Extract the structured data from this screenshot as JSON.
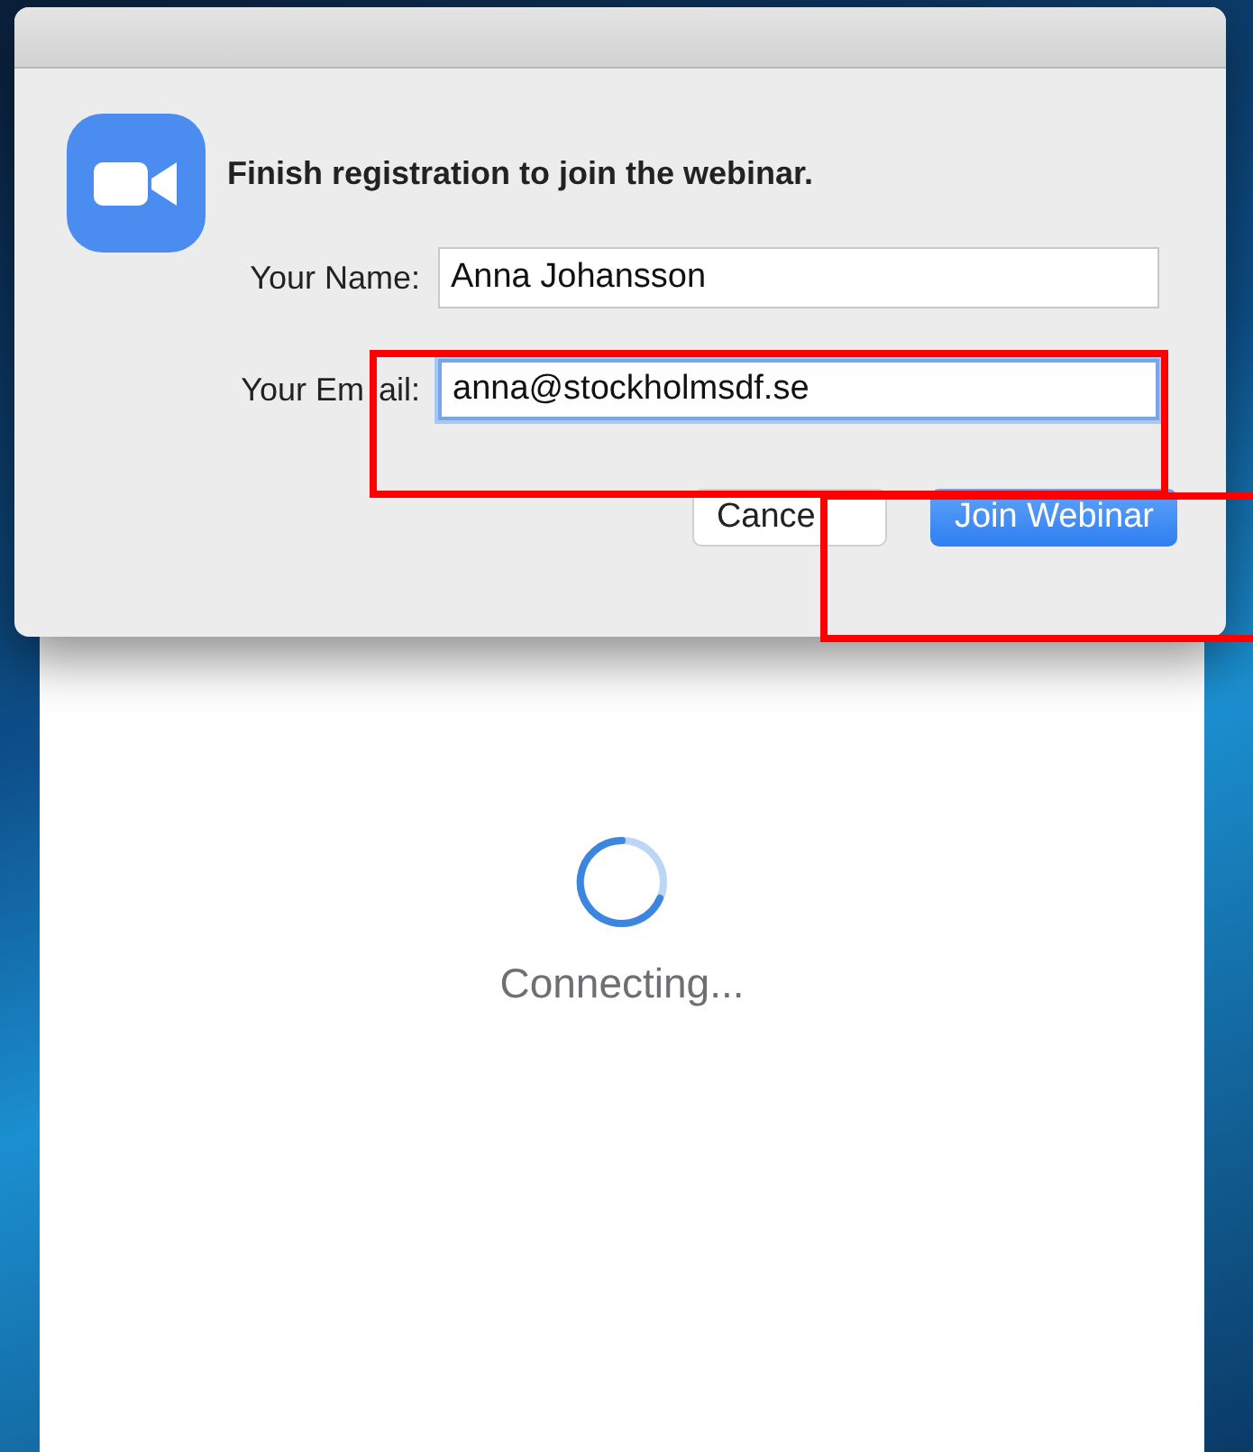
{
  "dialog": {
    "title": "Finish registration to join the webinar.",
    "fields": [
      {
        "label_parts": [
          "Your Name:"
        ],
        "value": "Anna Johansson",
        "focused": false
      },
      {
        "label_parts": [
          "Your Em",
          "ail:"
        ],
        "value": "anna@stockholmsdf.se",
        "focused": true
      }
    ],
    "buttons": [
      {
        "label": "Cance",
        "kind": "secondary"
      },
      {
        "label": "Join Webinar",
        "kind": "primary"
      }
    ]
  },
  "main_window": {
    "status": "Connecting..."
  }
}
